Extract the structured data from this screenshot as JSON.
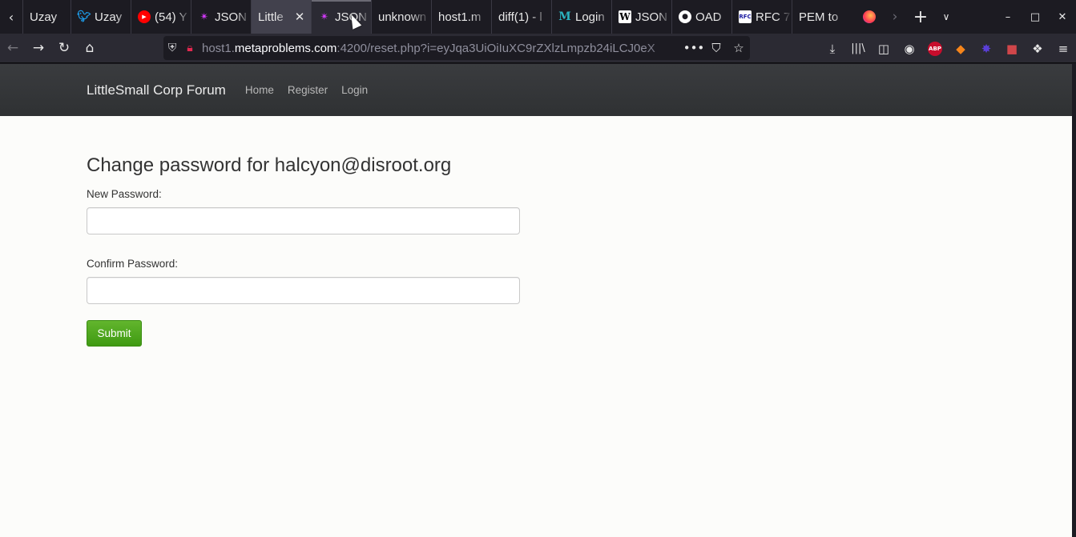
{
  "tabs": [
    {
      "title": "Uzay",
      "favicon": "none",
      "state": "normal"
    },
    {
      "title": "Uzay",
      "favicon": "twitter-icon",
      "state": "normal"
    },
    {
      "title": "(54) Y",
      "favicon": "youtube-icon",
      "state": "normal"
    },
    {
      "title": "JSON",
      "favicon": "jwt-icon",
      "state": "normal"
    },
    {
      "title": "Little",
      "favicon": "none",
      "state": "active"
    },
    {
      "title": "JSON",
      "favicon": "jwt-icon",
      "state": "hover"
    },
    {
      "title": "unknown",
      "favicon": "none",
      "state": "normal"
    },
    {
      "title": "host1.m",
      "favicon": "none",
      "state": "normal"
    },
    {
      "title": "diff(1) - l",
      "favicon": "none",
      "state": "normal"
    },
    {
      "title": "Login",
      "favicon": "m-icon",
      "state": "normal"
    },
    {
      "title": "JSON",
      "favicon": "wikipedia-icon",
      "state": "normal"
    },
    {
      "title": "OAD",
      "favicon": "github-icon",
      "state": "normal"
    },
    {
      "title": "RFC 7",
      "favicon": "rfc-icon",
      "state": "normal"
    },
    {
      "title": "PEM to",
      "favicon": "none",
      "state": "normal"
    }
  ],
  "url": {
    "prefix": "host1.",
    "host": "metaproblems.com",
    "rest": ":4200/reset.php?i=eyJqa3UiOiIuXC9rZXlzLmpzb24iLCJ0eX"
  },
  "site": {
    "brand": "LittleSmall Corp Forum",
    "nav": [
      "Home",
      "Register",
      "Login"
    ]
  },
  "form": {
    "heading": "Change password for halcyon@disroot.org",
    "new_password_label": "New Password:",
    "confirm_password_label": "Confirm Password:",
    "submit_label": "Submit"
  },
  "colors": {
    "submit_green": "#4ea71e",
    "site_nav_bg": "#333538",
    "browser_bg": "#1c1b22"
  }
}
